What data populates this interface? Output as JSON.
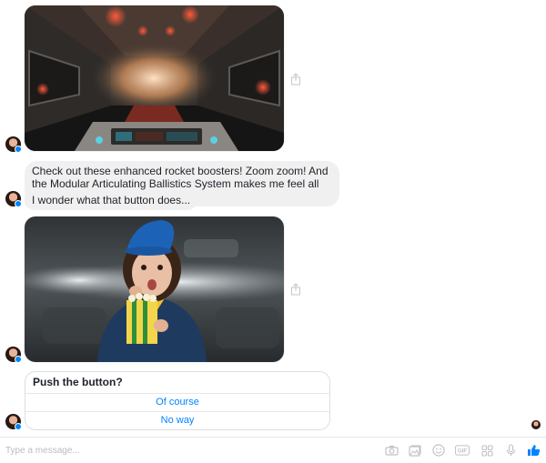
{
  "messages": {
    "text_1": "Check out these enhanced rocket boosters! Zoom zoom! And the Modular Articulating Ballistics System makes me feel all warm and fuzzy inside.",
    "text_2": "I wonder what that button does..."
  },
  "quick_reply": {
    "title": "Push the button?",
    "options": [
      "Of course",
      "No way"
    ]
  },
  "composer": {
    "placeholder": "Type a message..."
  },
  "icons": {
    "share": "share-icon",
    "camera": "camera-icon",
    "gallery": "gallery-icon",
    "emoji": "emoji-icon",
    "gif": "gif-icon",
    "apps": "apps-icon",
    "mic": "microphone-icon",
    "like": "thumbs-up-icon"
  },
  "colors": {
    "accent": "#0084ff",
    "bubble": "#f1f0f0"
  }
}
